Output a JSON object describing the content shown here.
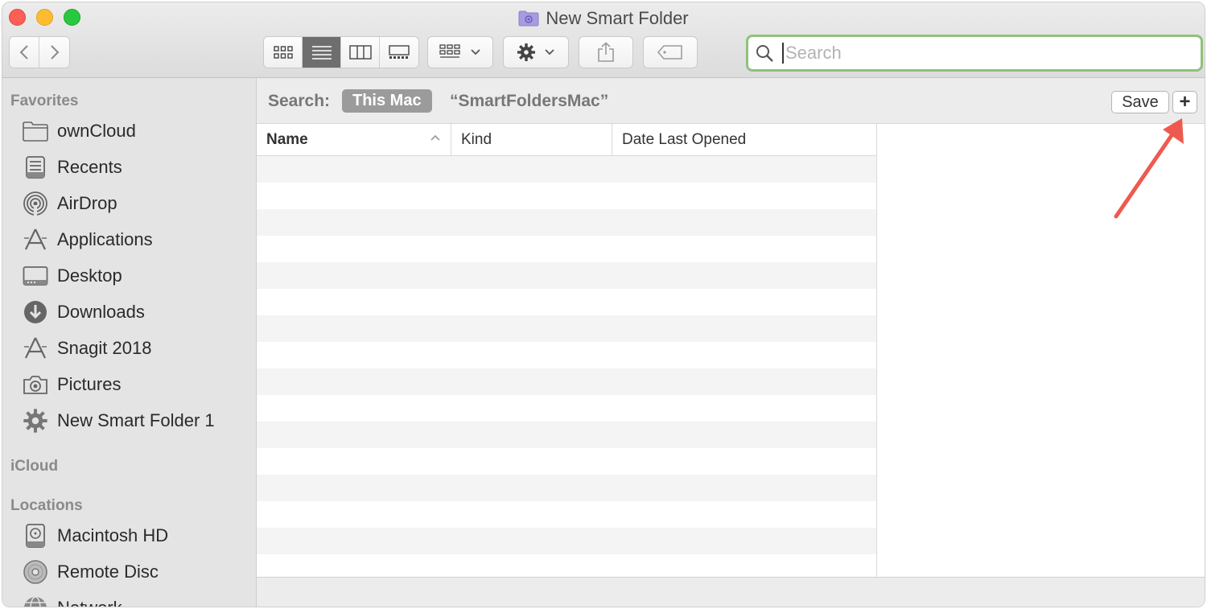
{
  "window": {
    "title": "New Smart Folder",
    "traffic_lights": {
      "close": "#fd5f57",
      "minimize": "#febc2e",
      "maximize": "#28c840"
    }
  },
  "toolbar": {
    "back_icon": "chevron-left-icon",
    "forward_icon": "chevron-right-icon",
    "view_modes": [
      "icon-view",
      "list-view",
      "column-view",
      "gallery-view"
    ],
    "active_view": "list-view",
    "group_icon": "group-icon",
    "action_icon": "gear-icon",
    "share_icon": "share-icon",
    "tag_icon": "tag-icon",
    "search_placeholder": "Search",
    "search_accent": "#8fc17c"
  },
  "sidebar": {
    "favorites_heading": "Favorites",
    "favorites": [
      {
        "label": "ownCloud",
        "icon": "folder-icon"
      },
      {
        "label": "Recents",
        "icon": "recents-icon"
      },
      {
        "label": "AirDrop",
        "icon": "airdrop-icon"
      },
      {
        "label": "Applications",
        "icon": "applications-icon"
      },
      {
        "label": "Desktop",
        "icon": "desktop-icon"
      },
      {
        "label": "Downloads",
        "icon": "downloads-icon"
      },
      {
        "label": "Snagit 2018",
        "icon": "applications-icon"
      },
      {
        "label": "Pictures",
        "icon": "camera-icon"
      },
      {
        "label": "New Smart Folder 1",
        "icon": "gear-icon"
      }
    ],
    "icloud_heading": "iCloud",
    "locations_heading": "Locations",
    "locations": [
      {
        "label": "Macintosh HD",
        "icon": "hard-drive-icon"
      },
      {
        "label": "Remote Disc",
        "icon": "disc-icon"
      },
      {
        "label": "Network",
        "icon": "network-icon"
      }
    ]
  },
  "scope": {
    "label": "Search:",
    "this_mac": "This Mac",
    "term": "“SmartFoldersMac”",
    "save_label": "Save",
    "add_label": "+"
  },
  "columns": {
    "name": "Name",
    "kind": "Kind",
    "date": "Date Last Opened"
  },
  "annotation": {
    "arrow_color": "#ee5a4f",
    "target": "add-criteria-button"
  }
}
